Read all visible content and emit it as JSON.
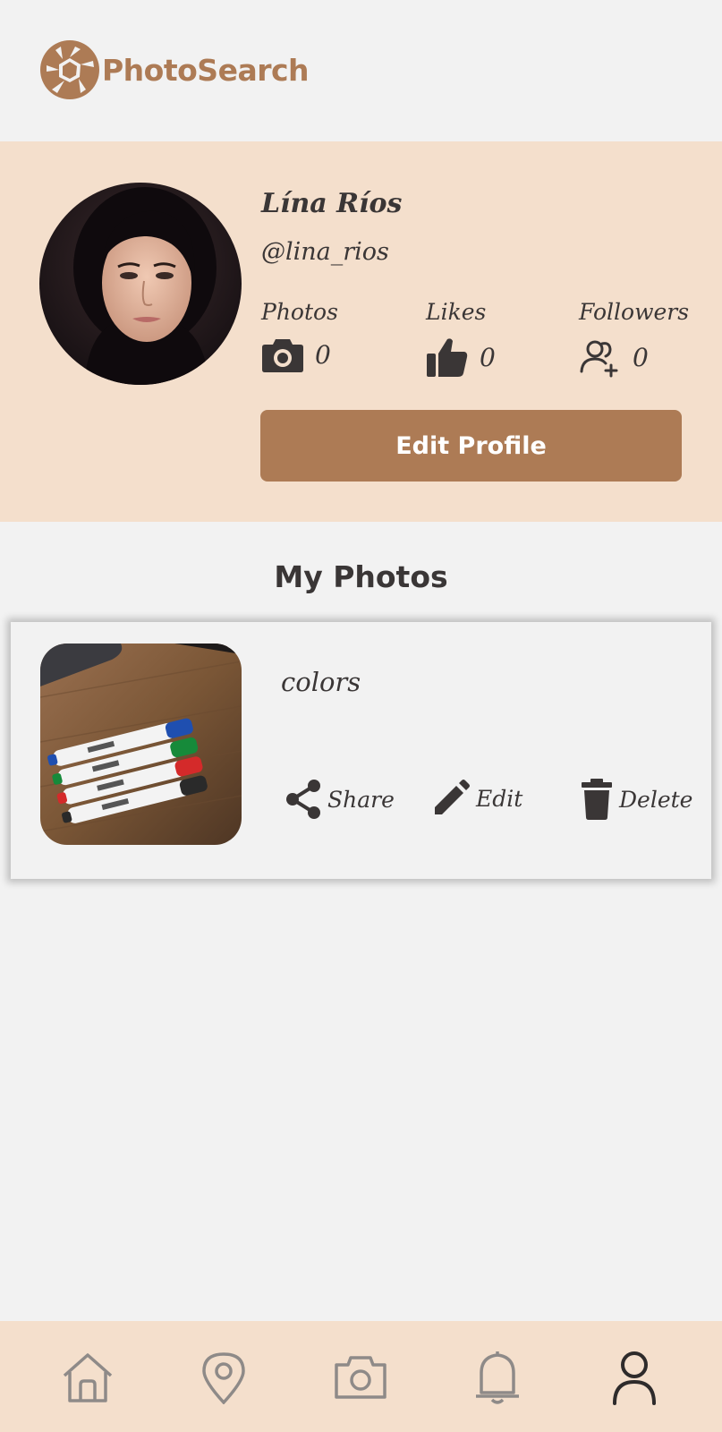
{
  "app": {
    "name": "PhotoSearch",
    "brand_color": "#ad7b55",
    "accent_bg": "#f4dfcc"
  },
  "profile": {
    "name": "Lína Ríos",
    "handle": "@lina_rios",
    "stats": [
      {
        "label": "Photos",
        "value": "0",
        "icon": "camera-icon"
      },
      {
        "label": "Likes",
        "value": "0",
        "icon": "thumbs-up-icon"
      },
      {
        "label": "Followers",
        "value": "0",
        "icon": "add-user-icon"
      }
    ],
    "edit_button": "Edit Profile"
  },
  "my_photos": {
    "title": "My Photos",
    "items": [
      {
        "title": "colors",
        "actions": [
          {
            "label": "Share",
            "icon": "share-icon"
          },
          {
            "label": "Edit",
            "icon": "pencil-icon"
          },
          {
            "label": "Delete",
            "icon": "trash-icon"
          }
        ]
      }
    ]
  },
  "bottom_nav": [
    {
      "icon": "home-icon",
      "active": false
    },
    {
      "icon": "map-pin-icon",
      "active": false
    },
    {
      "icon": "camera-icon",
      "active": false
    },
    {
      "icon": "bell-icon",
      "active": false
    },
    {
      "icon": "user-icon",
      "active": true
    }
  ]
}
